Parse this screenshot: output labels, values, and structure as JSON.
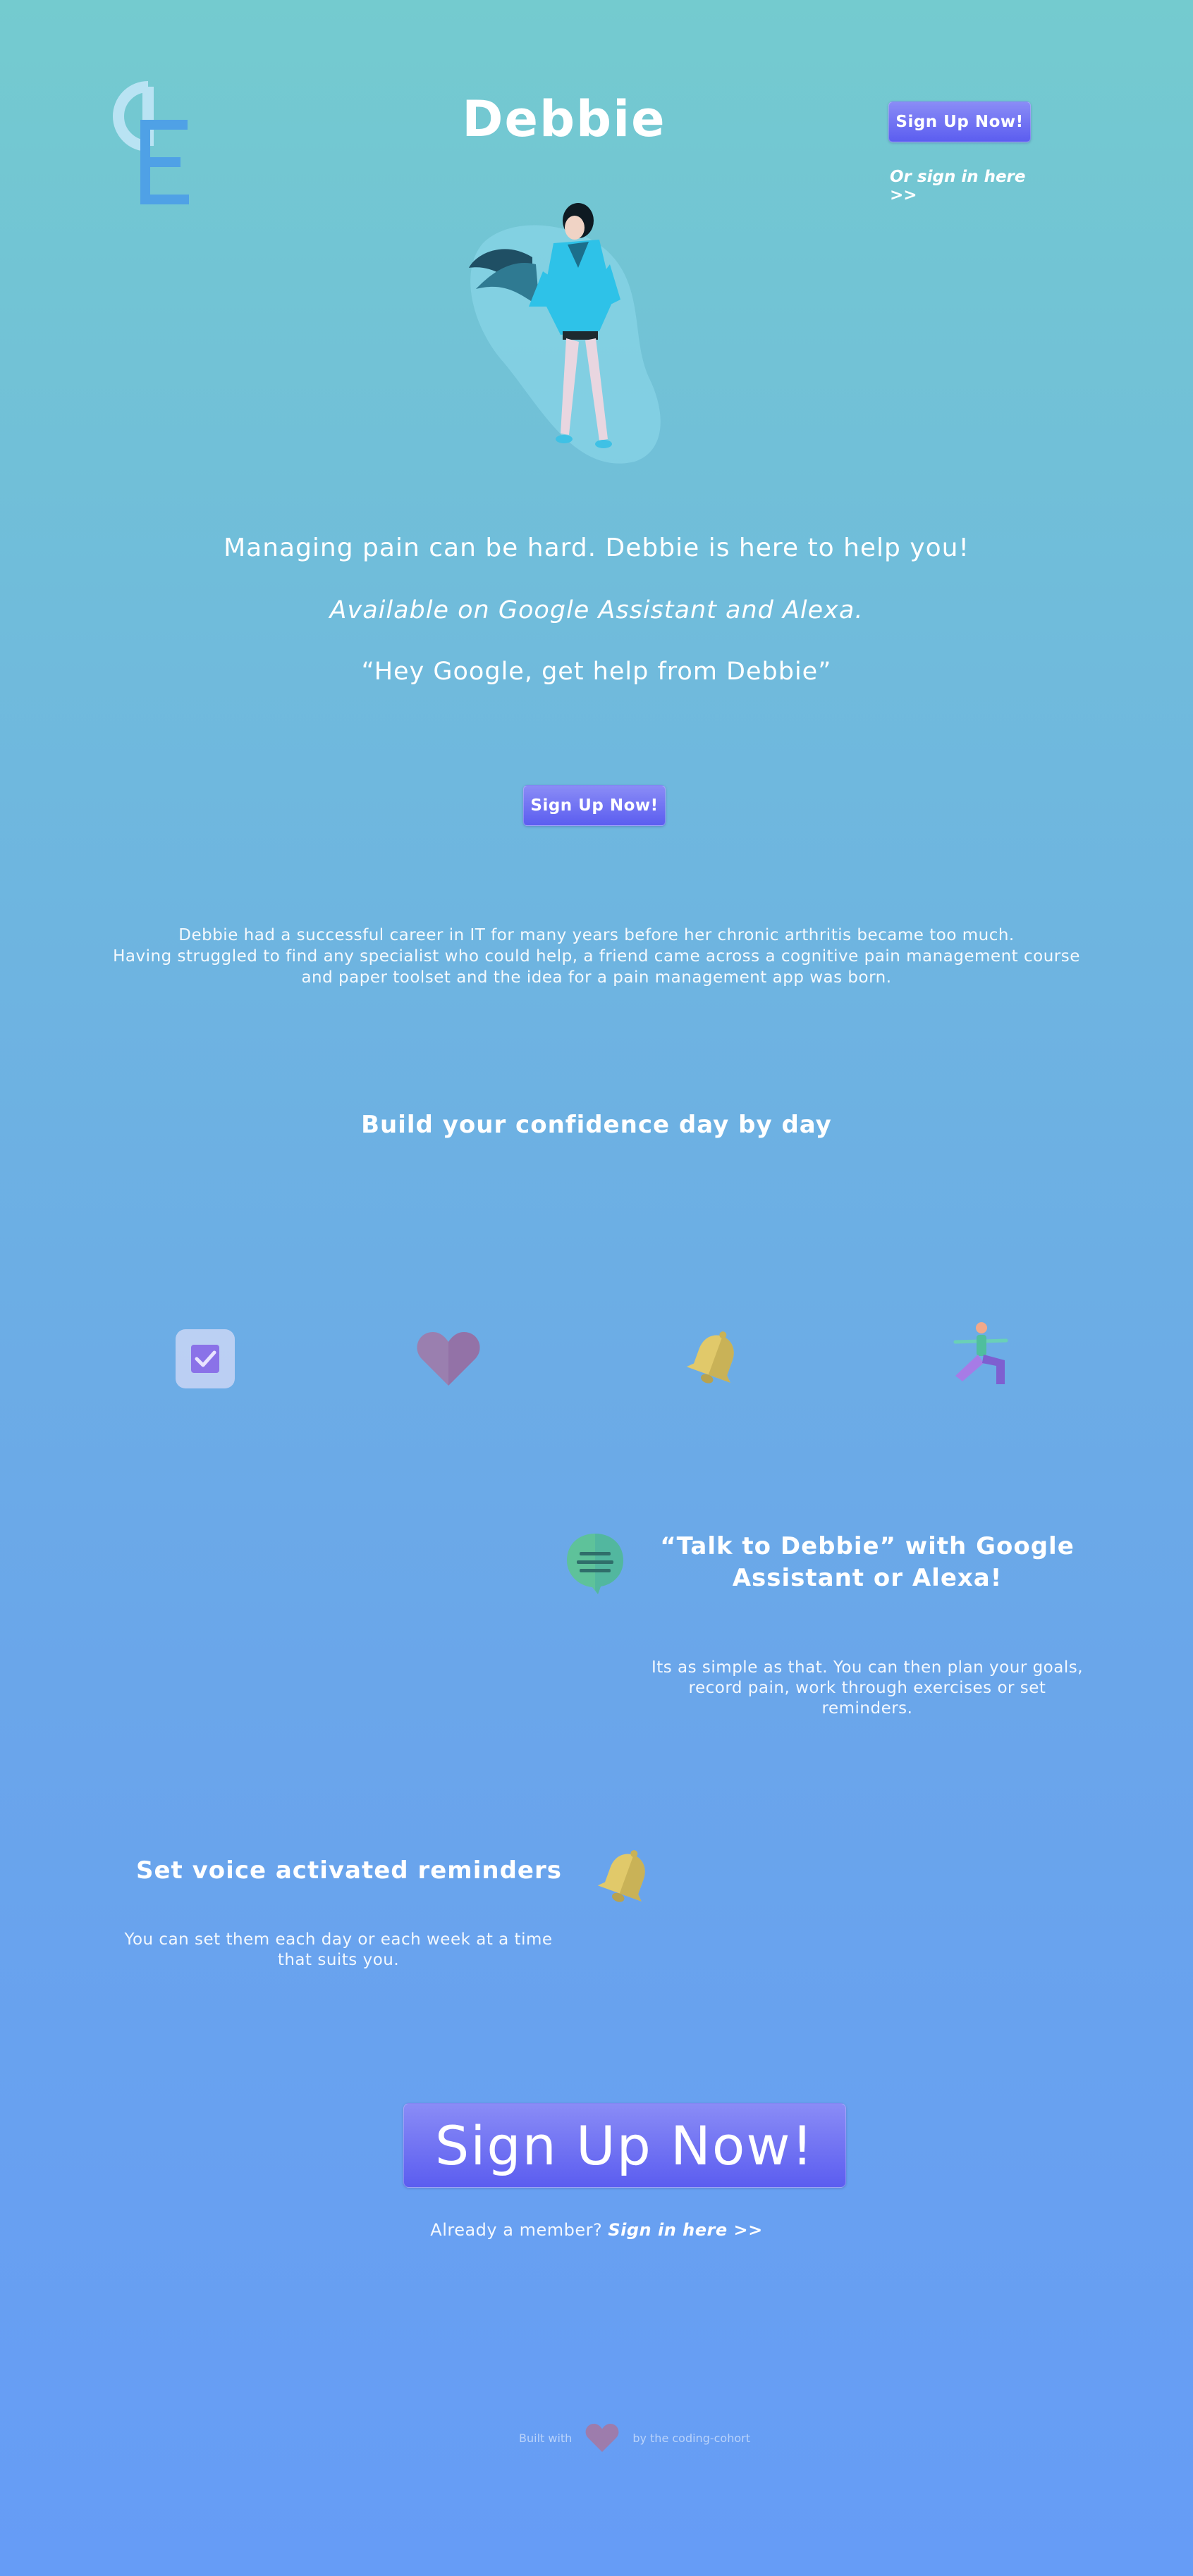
{
  "header": {
    "title": "Debbie",
    "signup_label": "Sign Up Now!",
    "signin_label": "Or sign in here >>",
    "logo_name": "debbie-logo"
  },
  "hero": {
    "tagline": "Managing pain can be hard. Debbie is here to help you!",
    "availability": "Available on Google Assistant and Alexa.",
    "invocation": "“Hey Google, get help from Debbie”",
    "signup_label": "Sign Up Now!"
  },
  "about": {
    "line1": "Debbie had a successful career in IT for many years before her chronic arthritis became too much.",
    "line2": "Having struggled to find any specialist who could help, a friend came across a cognitive pain management course",
    "line3": "and paper toolset and the idea for a pain management app was born."
  },
  "features": {
    "heading": "Build your confidence day by day",
    "icons": [
      "checkbox-icon",
      "heart-icon",
      "bell-icon",
      "yoga-pose-icon"
    ]
  },
  "talk": {
    "heading_line1": "“Talk to Debbie” with Google",
    "heading_line2": "Assistant or Alexa!",
    "body_line1": "Its as simple as that. You can then plan your goals,",
    "body_line2": "record pain, work through exercises or set",
    "body_line3": "reminders."
  },
  "reminders": {
    "heading": "Set voice activated reminders",
    "body_line1": "You can set them each day or each week at a time",
    "body_line2": "that suits you."
  },
  "cta": {
    "big_signup_label": "Sign Up Now!",
    "member_text": "Already a member?",
    "signin_label": "Sign in here >>"
  },
  "footer": {
    "built_with": "Built with",
    "by_text": "by the coding-cohort"
  },
  "colors": {
    "button_top": "#8a8cf6",
    "button_bottom": "#5b5df0",
    "heart": "#a07aa8",
    "bell": "#e1c96a",
    "logo_light": "#b9e3f3",
    "logo_dark": "#4fa1e6"
  }
}
